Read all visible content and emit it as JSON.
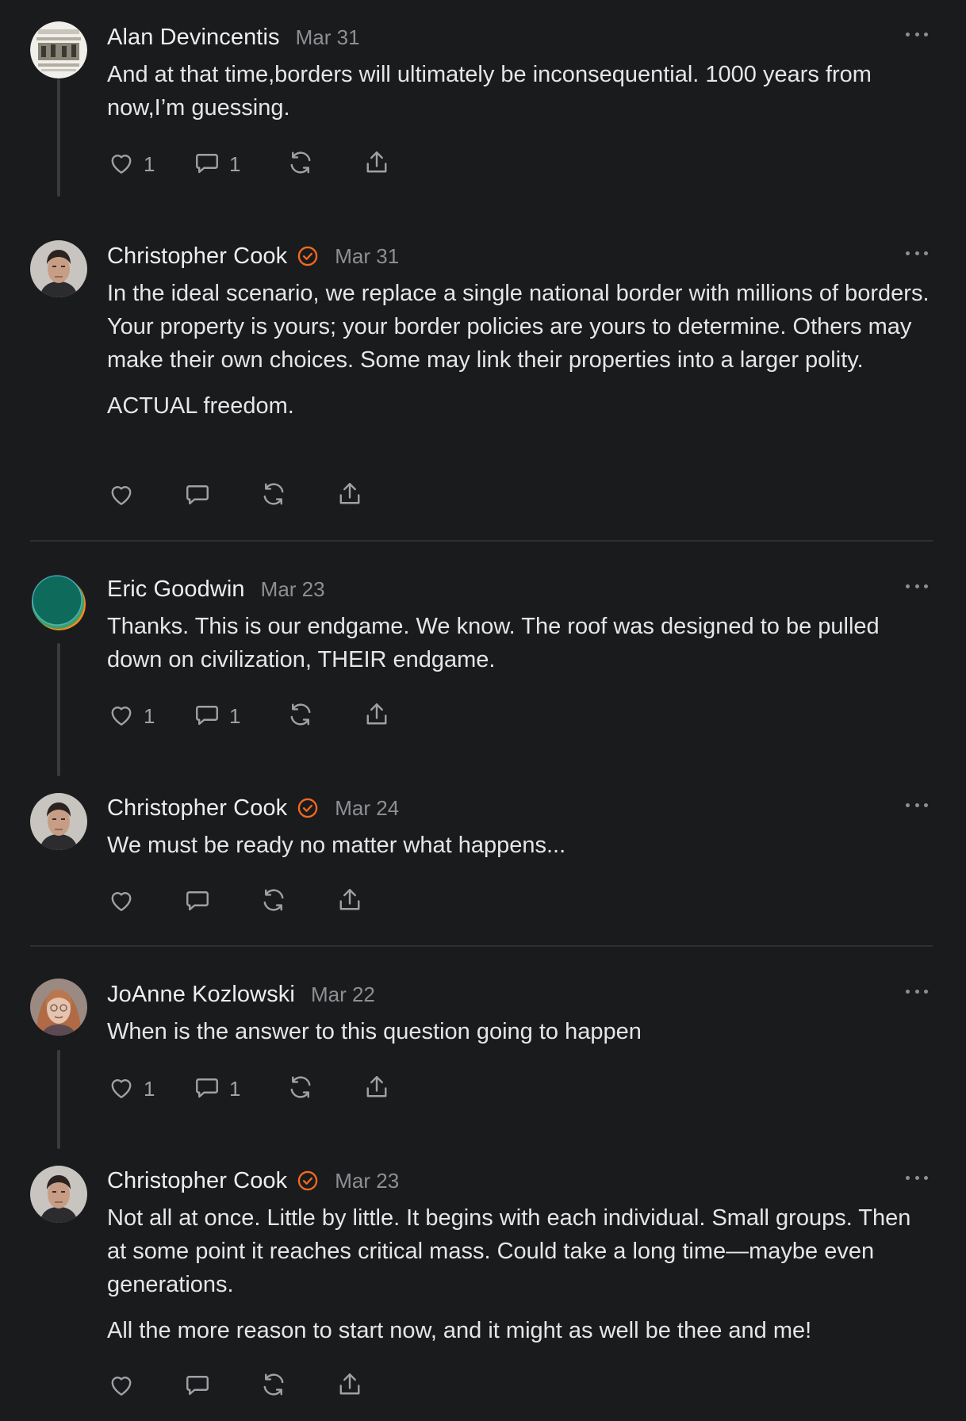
{
  "threads": [
    {
      "parent": {
        "author": "Alan Devincentis",
        "verified": false,
        "date": "Mar 31",
        "paragraphs": [
          "And at that time,borders will ultimately be inconsequential. 1000 years from now,I’m guessing."
        ],
        "like_count": "1",
        "reply_count": "1"
      },
      "reply": {
        "author": "Christopher Cook",
        "verified": true,
        "date": "Mar 31",
        "paragraphs": [
          "In the ideal scenario, we replace a single national border with millions of borders. Your property is yours; your border policies are yours to determine. Others may make their own choices. Some may link their properties into a larger polity.",
          "ACTUAL freedom."
        ]
      }
    },
    {
      "parent": {
        "author": "Eric Goodwin",
        "verified": false,
        "date": "Mar 23",
        "paragraphs": [
          "Thanks. This is our endgame. We know. The roof was designed to be pulled down on civilization, THEIR endgame."
        ],
        "like_count": "1",
        "reply_count": "1"
      },
      "reply": {
        "author": "Christopher Cook",
        "verified": true,
        "date": "Mar 24",
        "paragraphs": [
          "We must be ready no matter what happens..."
        ]
      }
    },
    {
      "parent": {
        "author": "JoAnne Kozlowski",
        "verified": false,
        "date": "Mar 22",
        "paragraphs": [
          "When is the answer to this question going to happen"
        ],
        "like_count": "1",
        "reply_count": "1"
      },
      "reply": {
        "author": "Christopher Cook",
        "verified": true,
        "date": "Mar 23",
        "paragraphs": [
          "Not all at once. Little by little. It begins with each individual. Small groups. Then at some point it reaches critical mass. Could take a long time—maybe even generations.",
          "All the more reason to start now, and it might as well be thee and me!"
        ]
      }
    }
  ],
  "colors": {
    "background": "#1a1b1d",
    "verified_badge": "#f26a21",
    "muted_text": "#8e8f93",
    "icon": "#a0a1a5"
  },
  "icons": {
    "like": "heart-icon",
    "reply": "comment-bubble-icon",
    "restack": "restack-icon",
    "share": "share-icon",
    "more": "more-dots-icon",
    "verified": "verified-badge-icon"
  }
}
